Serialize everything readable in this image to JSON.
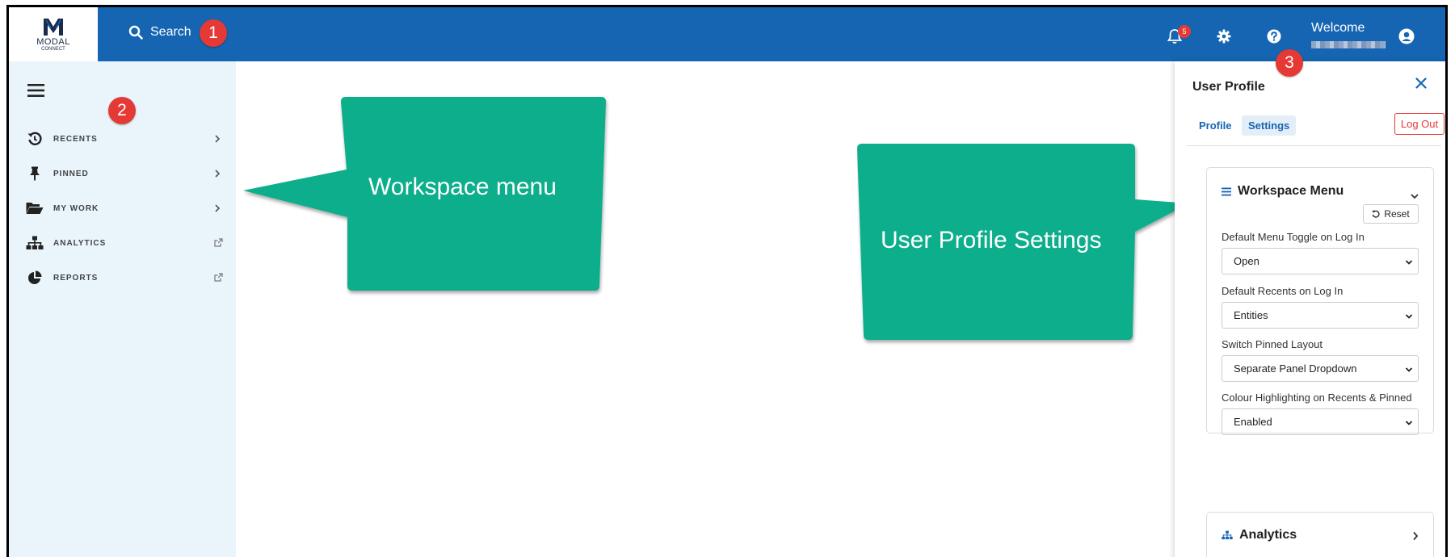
{
  "app": {
    "logo_text": "MODAL",
    "logo_subtext": "CONNECT",
    "search_label": "Search",
    "notification_count": "5",
    "welcome_label": "Welcome"
  },
  "annotations": {
    "marker_1": "1",
    "marker_2": "2",
    "marker_3": "3",
    "callout_workspace": "Workspace menu",
    "callout_profile": "User Profile Settings",
    "callout_color": "#0aae8c",
    "marker_color": "#e53935"
  },
  "sidebar": {
    "items": [
      {
        "label": "RECENTS",
        "icon": "history-icon",
        "trail": "chevron-right-icon"
      },
      {
        "label": "PINNED",
        "icon": "pin-icon",
        "trail": "chevron-right-icon"
      },
      {
        "label": "MY WORK",
        "icon": "folder-open-icon",
        "trail": "chevron-right-icon"
      },
      {
        "label": "ANALYTICS",
        "icon": "sitemap-icon",
        "trail": "external-link-icon"
      },
      {
        "label": "REPORTS",
        "icon": "pie-chart-icon",
        "trail": "external-link-icon"
      }
    ]
  },
  "profile_panel": {
    "title": "User Profile",
    "tabs": [
      {
        "label": "Profile",
        "active": false
      },
      {
        "label": "Settings",
        "active": true
      }
    ],
    "logout_label": "Log Out",
    "workspace_card": {
      "title": "Workspace Menu",
      "reset_label": "Reset",
      "fields": [
        {
          "label": "Default Menu Toggle on Log In",
          "value": "Open"
        },
        {
          "label": "Default Recents on Log In",
          "value": "Entities"
        },
        {
          "label": "Switch Pinned Layout",
          "value": "Separate Panel Dropdown"
        },
        {
          "label": "Colour Highlighting on Recents & Pinned",
          "value": "Enabled"
        }
      ]
    },
    "analytics_card": {
      "title": "Analytics"
    }
  },
  "colors": {
    "topbar": "#1565b3",
    "sidebar_bg": "#e9f4fb",
    "accent_red": "#e53935"
  }
}
